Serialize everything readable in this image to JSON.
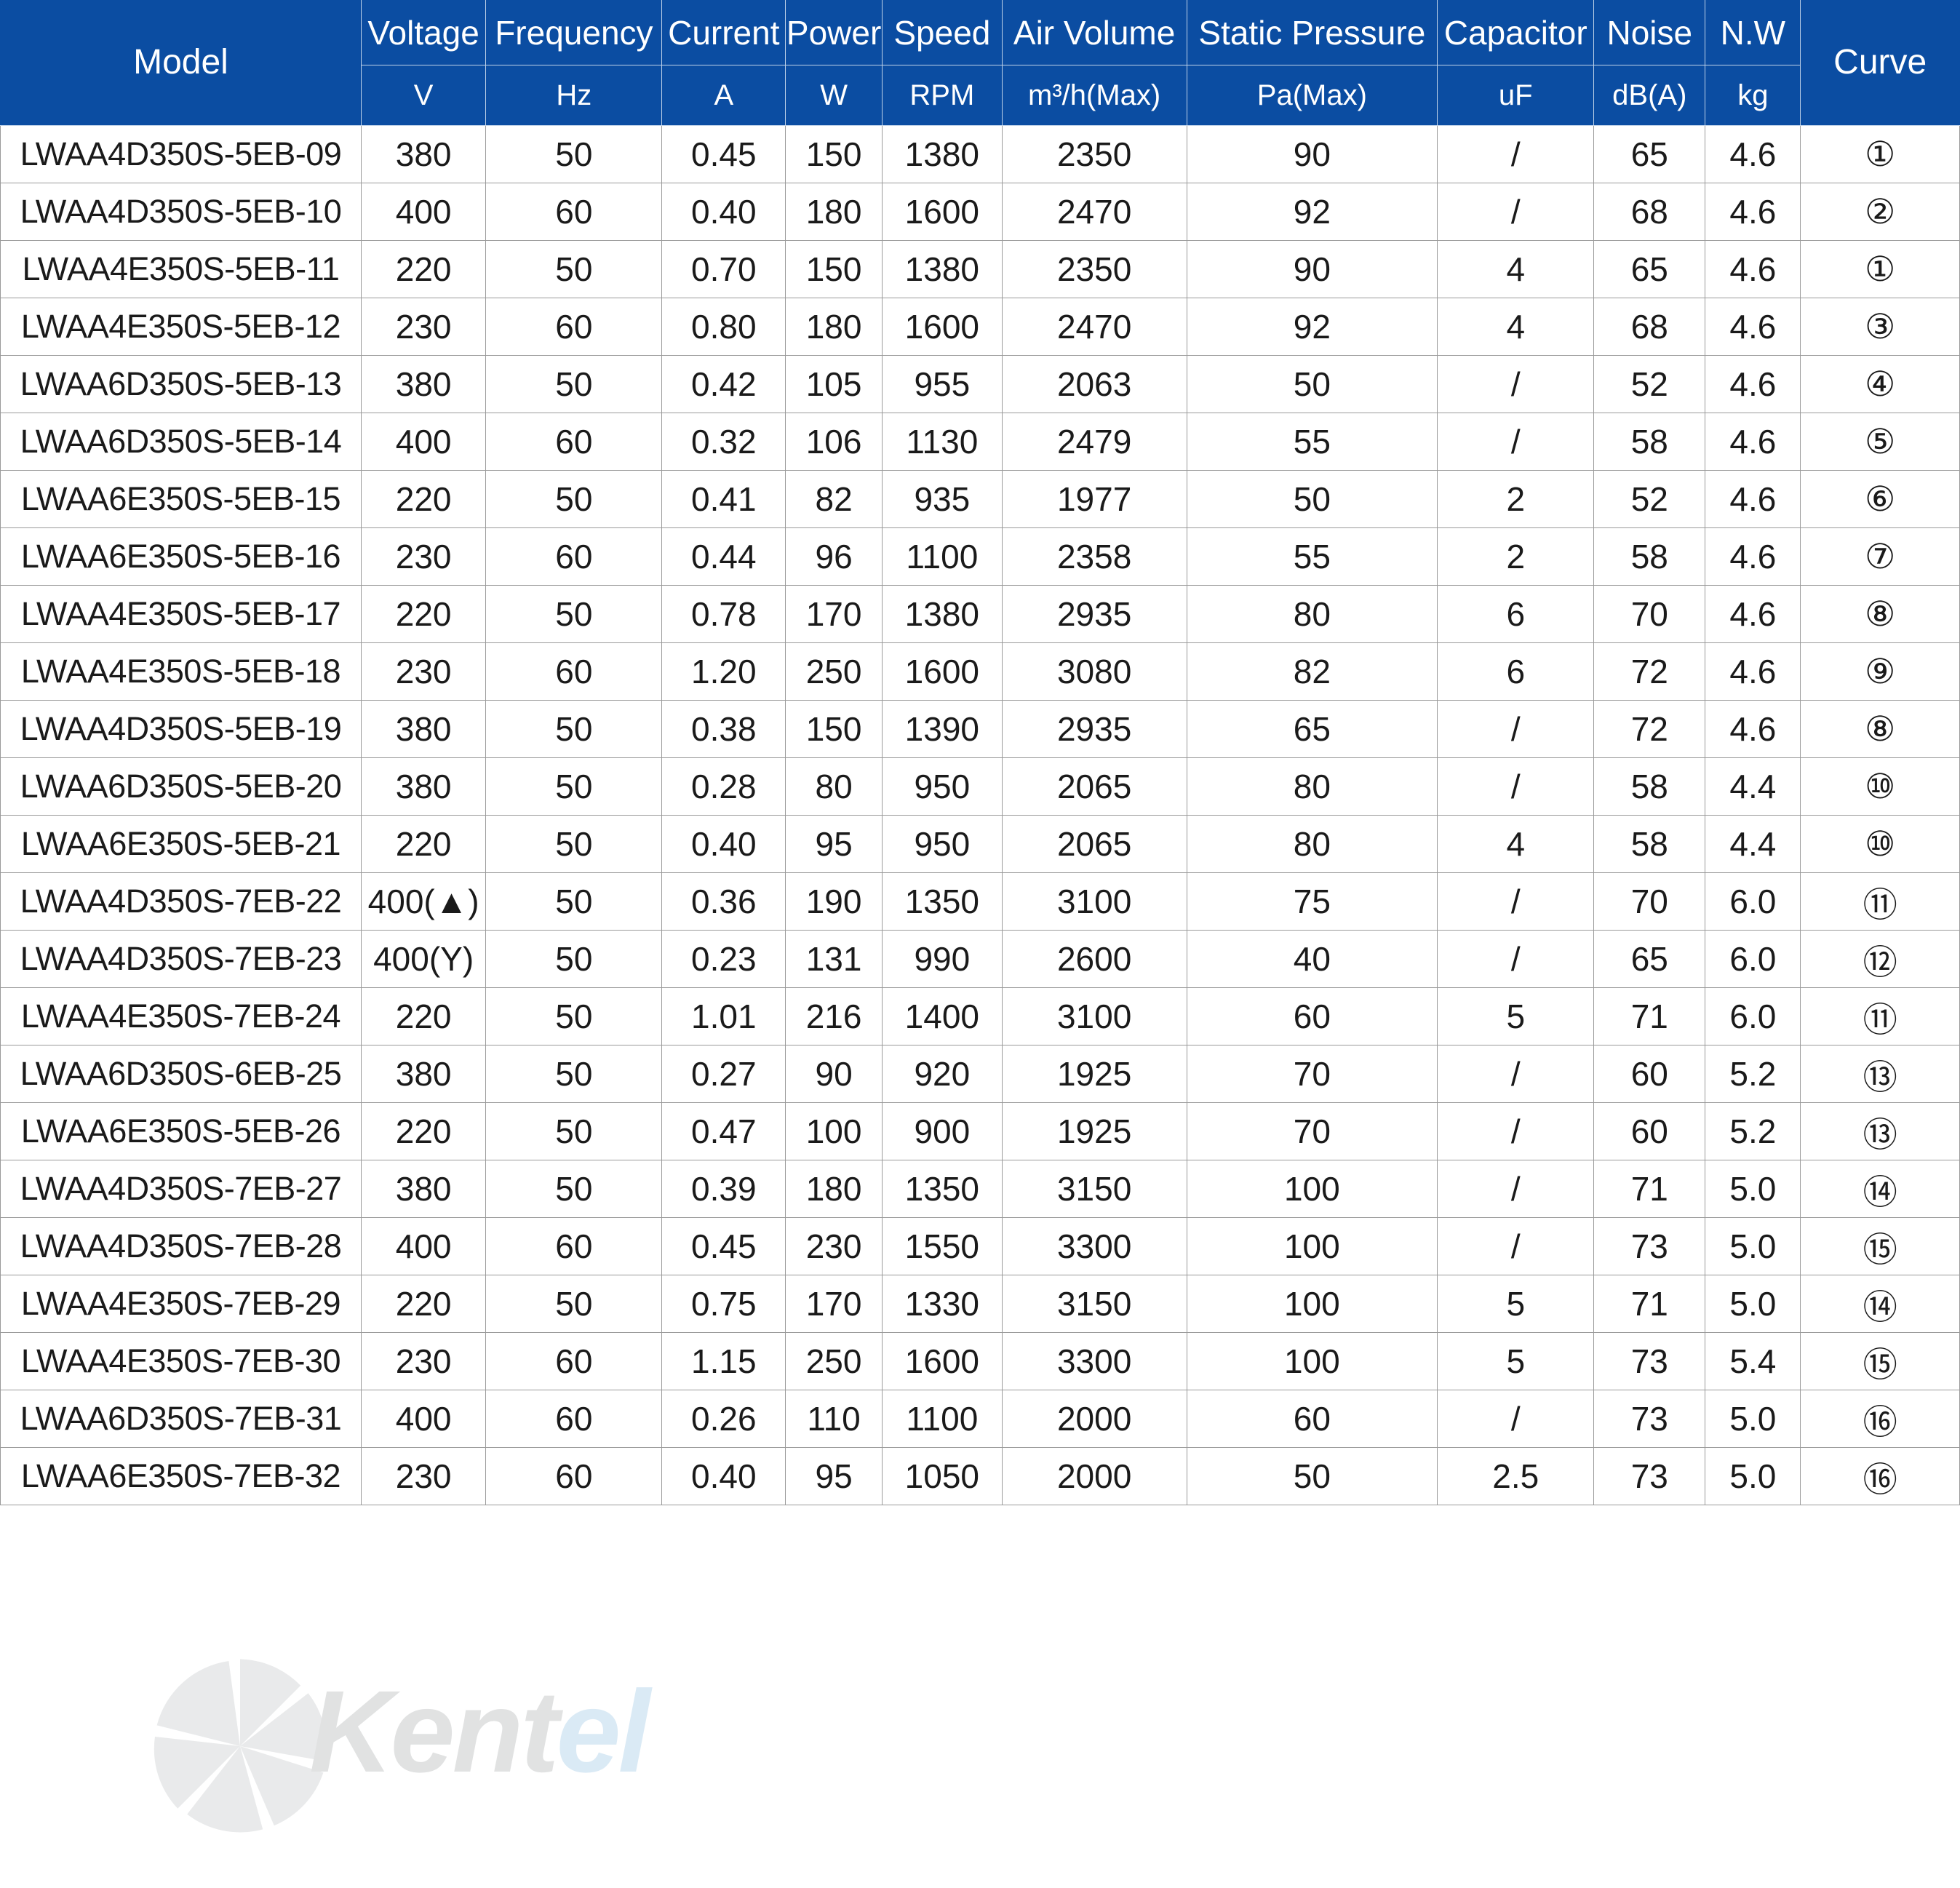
{
  "watermark": {
    "text_primary": "Kent",
    "text_secondary": "el"
  },
  "table": {
    "headers": [
      {
        "group": "Model",
        "unit": ""
      },
      {
        "group": "Voltage",
        "unit": "V"
      },
      {
        "group": "Frequency",
        "unit": "Hz"
      },
      {
        "group": "Current",
        "unit": "A"
      },
      {
        "group": "Power",
        "unit": "W"
      },
      {
        "group": "Speed",
        "unit": "RPM"
      },
      {
        "group": "Air Volume",
        "unit": "m³/h(Max)"
      },
      {
        "group": "Static Pressure",
        "unit": "Pa(Max)"
      },
      {
        "group": "Capacitor",
        "unit": "uF"
      },
      {
        "group": "Noise",
        "unit": "dB(A)"
      },
      {
        "group": "N.W",
        "unit": "kg"
      },
      {
        "group": "Curve",
        "unit": ""
      }
    ],
    "rows": [
      {
        "model": "LWAA4D350S-5EB-09",
        "voltage": "380",
        "frequency": "50",
        "current": "0.45",
        "power": "150",
        "speed": "1380",
        "air_volume": "2350",
        "static_pressure": "90",
        "capacitor": "/",
        "noise": "65",
        "nw": "4.6",
        "curve": "①"
      },
      {
        "model": "LWAA4D350S-5EB-10",
        "voltage": "400",
        "frequency": "60",
        "current": "0.40",
        "power": "180",
        "speed": "1600",
        "air_volume": "2470",
        "static_pressure": "92",
        "capacitor": "/",
        "noise": "68",
        "nw": "4.6",
        "curve": "②"
      },
      {
        "model": "LWAA4E350S-5EB-11",
        "voltage": "220",
        "frequency": "50",
        "current": "0.70",
        "power": "150",
        "speed": "1380",
        "air_volume": "2350",
        "static_pressure": "90",
        "capacitor": "4",
        "noise": "65",
        "nw": "4.6",
        "curve": "①"
      },
      {
        "model": "LWAA4E350S-5EB-12",
        "voltage": "230",
        "frequency": "60",
        "current": "0.80",
        "power": "180",
        "speed": "1600",
        "air_volume": "2470",
        "static_pressure": "92",
        "capacitor": "4",
        "noise": "68",
        "nw": "4.6",
        "curve": "③"
      },
      {
        "model": "LWAA6D350S-5EB-13",
        "voltage": "380",
        "frequency": "50",
        "current": "0.42",
        "power": "105",
        "speed": "955",
        "air_volume": "2063",
        "static_pressure": "50",
        "capacitor": "/",
        "noise": "52",
        "nw": "4.6",
        "curve": "④"
      },
      {
        "model": "LWAA6D350S-5EB-14",
        "voltage": "400",
        "frequency": "60",
        "current": "0.32",
        "power": "106",
        "speed": "1130",
        "air_volume": "2479",
        "static_pressure": "55",
        "capacitor": "/",
        "noise": "58",
        "nw": "4.6",
        "curve": "⑤"
      },
      {
        "model": "LWAA6E350S-5EB-15",
        "voltage": "220",
        "frequency": "50",
        "current": "0.41",
        "power": "82",
        "speed": "935",
        "air_volume": "1977",
        "static_pressure": "50",
        "capacitor": "2",
        "noise": "52",
        "nw": "4.6",
        "curve": "⑥"
      },
      {
        "model": "LWAA6E350S-5EB-16",
        "voltage": "230",
        "frequency": "60",
        "current": "0.44",
        "power": "96",
        "speed": "1100",
        "air_volume": "2358",
        "static_pressure": "55",
        "capacitor": "2",
        "noise": "58",
        "nw": "4.6",
        "curve": "⑦"
      },
      {
        "model": "LWAA4E350S-5EB-17",
        "voltage": "220",
        "frequency": "50",
        "current": "0.78",
        "power": "170",
        "speed": "1380",
        "air_volume": "2935",
        "static_pressure": "80",
        "capacitor": "6",
        "noise": "70",
        "nw": "4.6",
        "curve": "⑧"
      },
      {
        "model": "LWAA4E350S-5EB-18",
        "voltage": "230",
        "frequency": "60",
        "current": "1.20",
        "power": "250",
        "speed": "1600",
        "air_volume": "3080",
        "static_pressure": "82",
        "capacitor": "6",
        "noise": "72",
        "nw": "4.6",
        "curve": "⑨"
      },
      {
        "model": "LWAA4D350S-5EB-19",
        "voltage": "380",
        "frequency": "50",
        "current": "0.38",
        "power": "150",
        "speed": "1390",
        "air_volume": "2935",
        "static_pressure": "65",
        "capacitor": "/",
        "noise": "72",
        "nw": "4.6",
        "curve": "⑧"
      },
      {
        "model": "LWAA6D350S-5EB-20",
        "voltage": "380",
        "frequency": "50",
        "current": "0.28",
        "power": "80",
        "speed": "950",
        "air_volume": "2065",
        "static_pressure": "80",
        "capacitor": "/",
        "noise": "58",
        "nw": "4.4",
        "curve": "⑩"
      },
      {
        "model": "LWAA6E350S-5EB-21",
        "voltage": "220",
        "frequency": "50",
        "current": "0.40",
        "power": "95",
        "speed": "950",
        "air_volume": "2065",
        "static_pressure": "80",
        "capacitor": "4",
        "noise": "58",
        "nw": "4.4",
        "curve": "⑩"
      },
      {
        "model": "LWAA4D350S-7EB-22",
        "voltage": "400(▲)",
        "frequency": "50",
        "current": "0.36",
        "power": "190",
        "speed": "1350",
        "air_volume": "3100",
        "static_pressure": "75",
        "capacitor": "/",
        "noise": "70",
        "nw": "6.0",
        "curve": "⑪"
      },
      {
        "model": "LWAA4D350S-7EB-23",
        "voltage": "400(Y)",
        "frequency": "50",
        "current": "0.23",
        "power": "131",
        "speed": "990",
        "air_volume": "2600",
        "static_pressure": "40",
        "capacitor": "/",
        "noise": "65",
        "nw": "6.0",
        "curve": "⑫"
      },
      {
        "model": "LWAA4E350S-7EB-24",
        "voltage": "220",
        "frequency": "50",
        "current": "1.01",
        "power": "216",
        "speed": "1400",
        "air_volume": "3100",
        "static_pressure": "60",
        "capacitor": "5",
        "noise": "71",
        "nw": "6.0",
        "curve": "⑪"
      },
      {
        "model": "LWAA6D350S-6EB-25",
        "voltage": "380",
        "frequency": "50",
        "current": "0.27",
        "power": "90",
        "speed": "920",
        "air_volume": "1925",
        "static_pressure": "70",
        "capacitor": "/",
        "noise": "60",
        "nw": "5.2",
        "curve": "⑬"
      },
      {
        "model": "LWAA6E350S-5EB-26",
        "voltage": "220",
        "frequency": "50",
        "current": "0.47",
        "power": "100",
        "speed": "900",
        "air_volume": "1925",
        "static_pressure": "70",
        "capacitor": "/",
        "noise": "60",
        "nw": "5.2",
        "curve": "⑬"
      },
      {
        "model": "LWAA4D350S-7EB-27",
        "voltage": "380",
        "frequency": "50",
        "current": "0.39",
        "power": "180",
        "speed": "1350",
        "air_volume": "3150",
        "static_pressure": "100",
        "capacitor": "/",
        "noise": "71",
        "nw": "5.0",
        "curve": "⑭"
      },
      {
        "model": "LWAA4D350S-7EB-28",
        "voltage": "400",
        "frequency": "60",
        "current": "0.45",
        "power": "230",
        "speed": "1550",
        "air_volume": "3300",
        "static_pressure": "100",
        "capacitor": "/",
        "noise": "73",
        "nw": "5.0",
        "curve": "⑮"
      },
      {
        "model": "LWAA4E350S-7EB-29",
        "voltage": "220",
        "frequency": "50",
        "current": "0.75",
        "power": "170",
        "speed": "1330",
        "air_volume": "3150",
        "static_pressure": "100",
        "capacitor": "5",
        "noise": "71",
        "nw": "5.0",
        "curve": "⑭"
      },
      {
        "model": "LWAA4E350S-7EB-30",
        "voltage": "230",
        "frequency": "60",
        "current": "1.15",
        "power": "250",
        "speed": "1600",
        "air_volume": "3300",
        "static_pressure": "100",
        "capacitor": "5",
        "noise": "73",
        "nw": "5.4",
        "curve": "⑮"
      },
      {
        "model": "LWAA6D350S-7EB-31",
        "voltage": "400",
        "frequency": "60",
        "current": "0.26",
        "power": "110",
        "speed": "1100",
        "air_volume": "2000",
        "static_pressure": "60",
        "capacitor": "/",
        "noise": "73",
        "nw": "5.0",
        "curve": "⑯"
      },
      {
        "model": "LWAA6E350S-7EB-32",
        "voltage": "230",
        "frequency": "60",
        "current": "0.40",
        "power": "95",
        "speed": "1050",
        "air_volume": "2000",
        "static_pressure": "50",
        "capacitor": "2.5",
        "noise": "73",
        "nw": "5.0",
        "curve": "⑯"
      }
    ]
  },
  "colors": {
    "header_bg": "#0b4da2",
    "header_text": "#ffffff",
    "grid": "#9a9a9a",
    "body_text": "#1a1a1a",
    "watermark_gray": "#c9cbcc",
    "watermark_blue": "#bcd9ee"
  }
}
